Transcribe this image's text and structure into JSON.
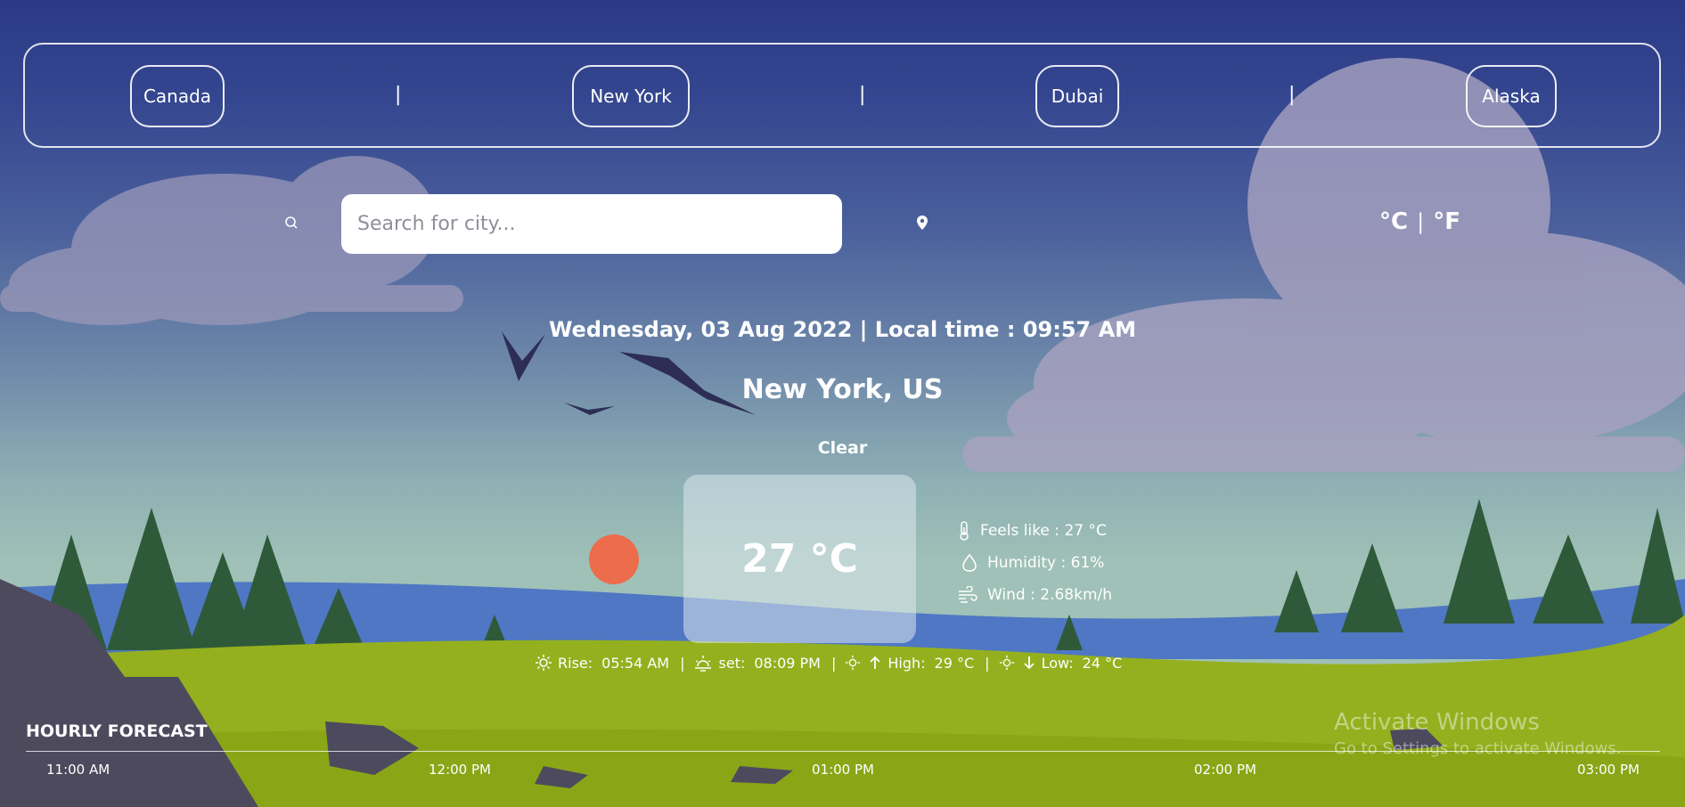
{
  "cities": [
    "Canada",
    "New York",
    "Dubai",
    "Alaska"
  ],
  "separator": "|",
  "search": {
    "placeholder": "Search for city...",
    "icon": "search-icon",
    "location_icon": "location-pin-icon"
  },
  "units": {
    "celsius": "°C",
    "fahrenheit": "°F",
    "divider": "|"
  },
  "current": {
    "datetime": "Wednesday, 03 Aug 2022 | Local time : 09:57 AM",
    "location": "New York, US",
    "condition": "Clear",
    "temperature": "27 °C",
    "weather_icon": "sun-icon",
    "sun_color": "#ec6c4c"
  },
  "details": {
    "feels_like": {
      "label": "Feels like :",
      "value": "27 °C",
      "icon": "thermometer-icon"
    },
    "humidity": {
      "label": "Humidity :",
      "value": "61%",
      "icon": "droplet-icon"
    },
    "wind": {
      "label": "Wind :",
      "value": "2.68km/h",
      "icon": "wind-icon"
    }
  },
  "astro": {
    "rise_label": "Rise:",
    "rise_value": "05:54 AM",
    "set_label": "set:",
    "set_value": "08:09 PM",
    "high_label": "High:",
    "high_value": "29 °C",
    "low_label": "Low:",
    "low_value": "24 °C",
    "divider": "|"
  },
  "hourly": {
    "title": "HOURLY FORECAST",
    "times": [
      "11:00 AM",
      "12:00 PM",
      "01:00 PM",
      "02:00 PM",
      "03:00 PM"
    ]
  },
  "watermark": {
    "line1": "Activate Windows",
    "line2": "Go to Settings to activate Windows."
  }
}
